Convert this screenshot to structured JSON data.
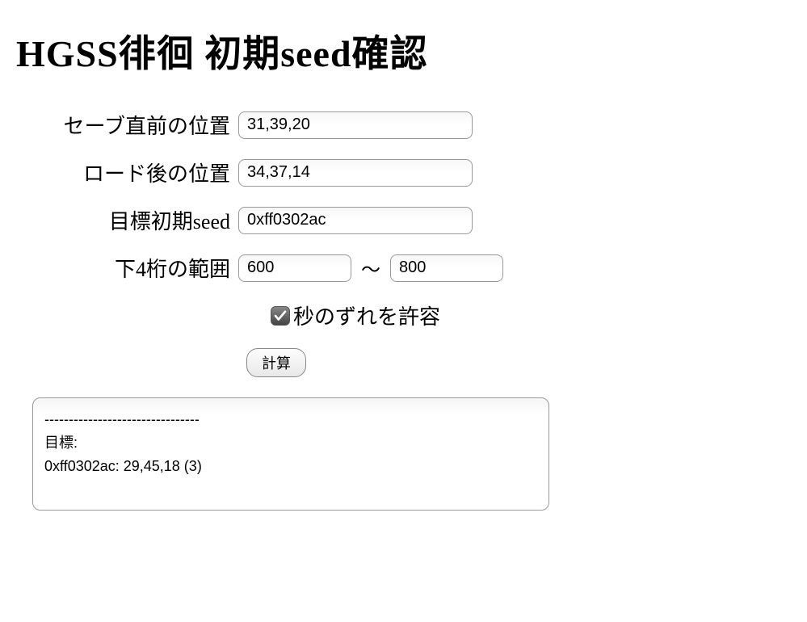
{
  "title": "HGSS徘徊 初期seed確認",
  "form": {
    "save_pos_label": "セーブ直前の位置",
    "save_pos_value": "31,39,20",
    "load_pos_label": "ロード後の位置",
    "load_pos_value": "34,37,14",
    "target_seed_label": "目標初期seed",
    "target_seed_value": "0xff0302ac",
    "range_label": "下4桁の範囲",
    "range_from": "600",
    "range_to": "800",
    "range_tilde": "〜",
    "tolerance_label": "秒のずれを許容",
    "tolerance_checked": true,
    "calc_button": "計算"
  },
  "output": "--------------------------------\n目標:\n0xff0302ac: 29,45,18 (3)"
}
